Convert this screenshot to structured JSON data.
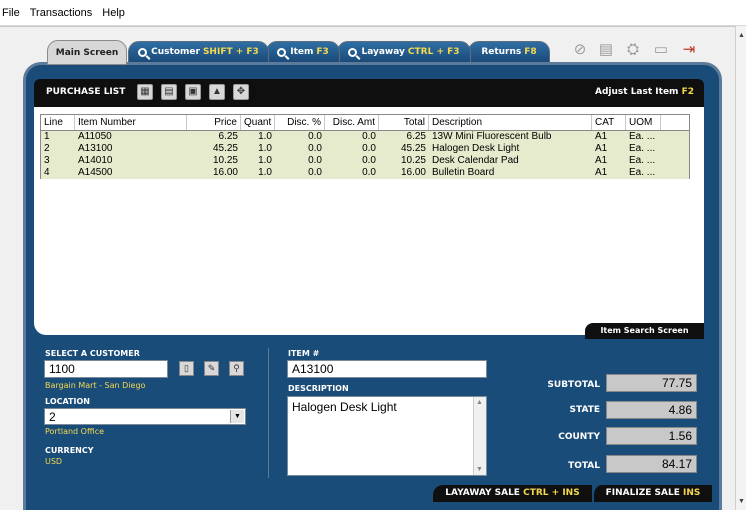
{
  "menu": {
    "file": "File",
    "transactions": "Transactions",
    "help": "Help"
  },
  "tabs": {
    "main": "Main Screen",
    "customer": "Customer",
    "customer_hotkey": "SHIFT + F3",
    "item": "Item",
    "item_hotkey": "F3",
    "layaway": "Layaway",
    "layaway_hotkey": "CTRL + F3",
    "returns": "Returns",
    "returns_hotkey": "F8"
  },
  "purchase_list": {
    "title": "PURCHASE LIST",
    "adjust_label": "Adjust Last Item",
    "adjust_hotkey": "F2",
    "columns": [
      "Line",
      "Item Number",
      "Price",
      "Quant",
      "Disc. %",
      "Disc. Amt",
      "Total",
      "Description",
      "CAT",
      "UOM"
    ],
    "rows": [
      [
        "1",
        "A11050",
        "6.25",
        "1.0",
        "0.0",
        "0.0",
        "6.25",
        "13W Mini Fluorescent Bulb",
        "A1",
        "Ea. ..."
      ],
      [
        "2",
        "A13100",
        "45.25",
        "1.0",
        "0.0",
        "0.0",
        "45.25",
        "Halogen Desk Light",
        "A1",
        "Ea. ..."
      ],
      [
        "3",
        "A14010",
        "10.25",
        "1.0",
        "0.0",
        "0.0",
        "10.25",
        "Desk Calendar Pad",
        "A1",
        "Ea. ..."
      ],
      [
        "4",
        "A14500",
        "16.00",
        "1.0",
        "0.0",
        "0.0",
        "16.00",
        "Bulletin Board",
        "A1",
        "Ea. ..."
      ]
    ],
    "item_search_tab": "Item Search Screen"
  },
  "customer": {
    "label": "SELECT A CUSTOMER",
    "value": "1100",
    "name": "Bargain Mart - San Diego"
  },
  "location": {
    "label": "LOCATION",
    "value": "2",
    "name": "Portland Office"
  },
  "currency": {
    "label": "CURRENCY",
    "value": "USD"
  },
  "item": {
    "label": "ITEM #",
    "value": "A13100",
    "description_label": "DESCRIPTION",
    "description": "Halogen Desk Light"
  },
  "totals": {
    "subtotal_label": "SUBTOTAL",
    "subtotal": "77.75",
    "state_label": "STATE",
    "state": "4.86",
    "county_label": "COUNTY",
    "county": "1.56",
    "total_label": "TOTAL",
    "total": "84.17"
  },
  "actions": {
    "layaway_sale": "LAYAWAY SALE",
    "layaway_hotkey": "CTRL + INS",
    "finalize_sale": "FINALIZE SALE",
    "finalize_hotkey": "INS"
  }
}
